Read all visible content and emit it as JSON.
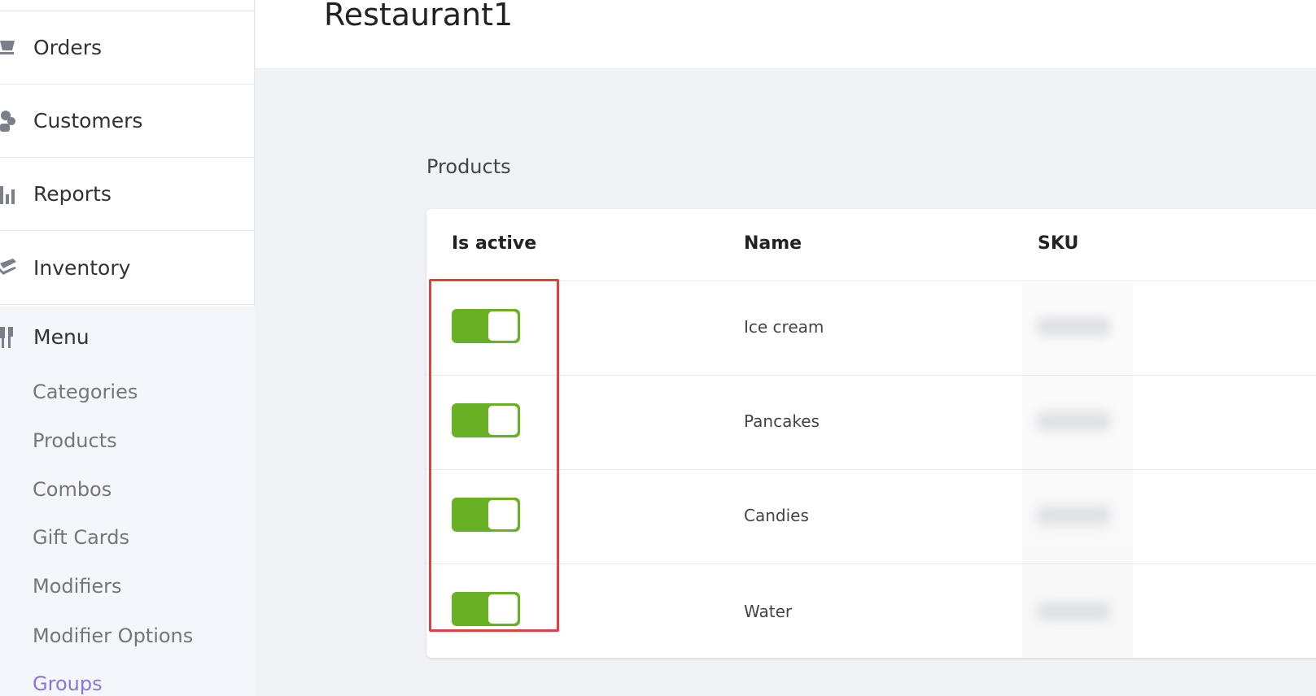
{
  "sidebar": {
    "items": [
      {
        "label": "Orders",
        "icon": "cart-icon"
      },
      {
        "label": "Customers",
        "icon": "users-icon"
      },
      {
        "label": "Reports",
        "icon": "bar-chart-icon"
      },
      {
        "label": "Inventory",
        "icon": "layers-icon"
      }
    ],
    "menu": {
      "label": "Menu",
      "icon": "utensils-icon",
      "subitems": [
        {
          "label": "Categories"
        },
        {
          "label": "Products"
        },
        {
          "label": "Combos"
        },
        {
          "label": "Gift Cards"
        },
        {
          "label": "Modifiers"
        },
        {
          "label": "Modifier Options"
        },
        {
          "label": "Groups",
          "active": true
        }
      ]
    }
  },
  "header": {
    "title": "Restaurant1"
  },
  "main": {
    "section_title": "Products",
    "table": {
      "columns": [
        "Is active",
        "Name",
        "SKU"
      ],
      "rows": [
        {
          "is_active": true,
          "name": "Ice cream"
        },
        {
          "is_active": true,
          "name": "Pancakes"
        },
        {
          "is_active": true,
          "name": "Candies"
        },
        {
          "is_active": true,
          "name": "Water"
        }
      ]
    }
  },
  "colors": {
    "toggle_on": "#6ab023",
    "active_link": "#8b74e0",
    "highlight": "#e04040"
  }
}
